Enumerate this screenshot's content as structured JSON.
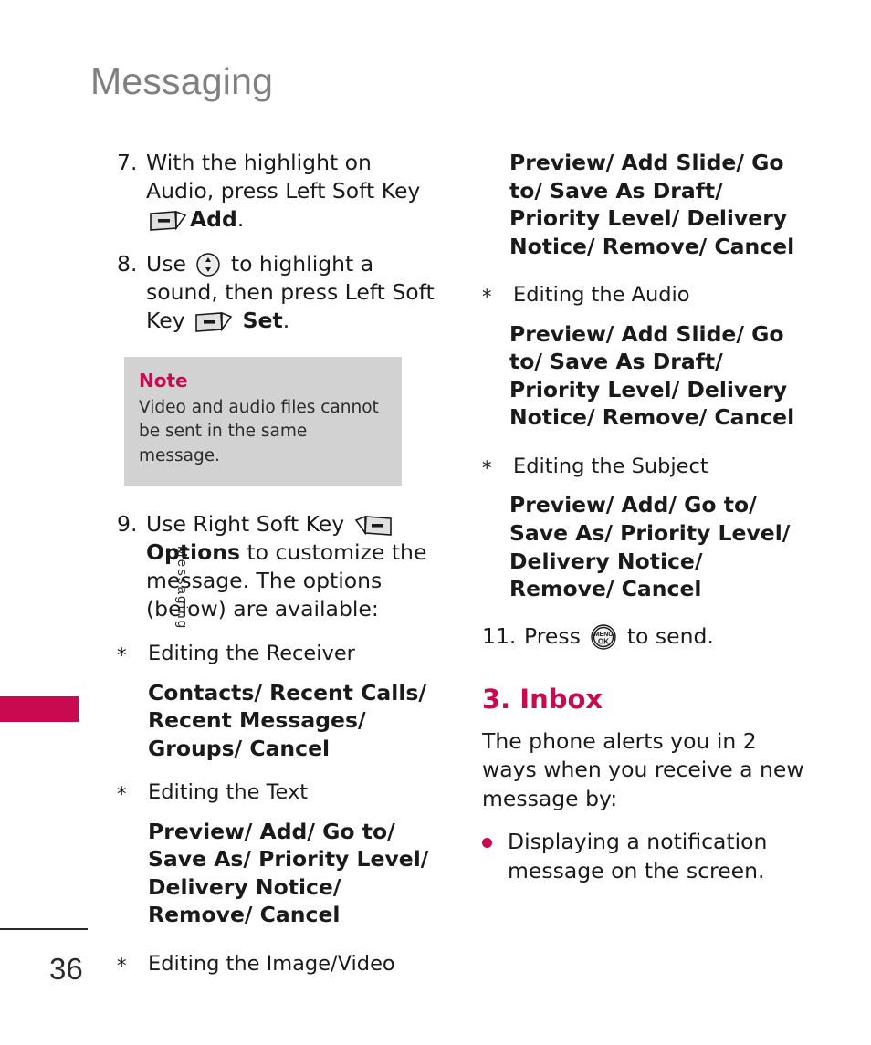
{
  "colors": {
    "accent_magenta": "#c80a50",
    "chapter_gray": "#808080",
    "note_bg": "#d2d2d2",
    "body_text": "#1a1a1a"
  },
  "chapter": {
    "title": "Messaging",
    "side_tab_label": "Messaging"
  },
  "footer": {
    "page_number": "36"
  },
  "icons": {
    "left_soft_key": "left-soft-key-icon",
    "right_soft_key": "right-soft-key-icon",
    "navigation_wheel": "navigation-wheel-icon",
    "menu_ok_key": "menu-ok-key-icon",
    "menu_ok_top_label": "MENU",
    "menu_ok_bottom_label": "OK"
  },
  "left_column": {
    "step7": {
      "number": "7.",
      "text_before": "With the highlight on Audio, press Left Soft Key",
      "text_after": "Add",
      "text_end": "."
    },
    "step8": {
      "number": "8.",
      "text_before": "Use",
      "text_middle": "to highlight a sound, then press Left Soft Key",
      "text_after": "Set",
      "text_end": "."
    },
    "note": {
      "title": "Note",
      "body": "Video and audio files cannot be sent in the same message."
    },
    "step9": {
      "number": "9.",
      "text_before": "Use Right Soft Key",
      "text_bold": "Options",
      "text_after": "to customize the message. The options (below) are available:"
    },
    "bullets": [
      {
        "mark": "*",
        "label": "Editing the Receiver",
        "options": "Contacts/ Recent Calls/ Recent Messages/ Groups/ Cancel"
      },
      {
        "mark": "*",
        "label": "Editing the Text",
        "options": "Preview/ Add/ Go to/ Save As/ Priority Level/ Delivery Notice/ Remove/ Cancel"
      },
      {
        "mark": "*",
        "label": "Editing the Image/Video",
        "options": ""
      }
    ]
  },
  "right_column": {
    "continued_options": "Preview/ Add Slide/ Go to/ Save As Draft/ Priority Level/ Delivery Notice/ Remove/ Cancel",
    "bullets": [
      {
        "mark": "*",
        "label": "Editing the Audio",
        "options": "Preview/ Add Slide/ Go to/ Save As Draft/ Priority Level/ Delivery Notice/ Remove/ Cancel"
      },
      {
        "mark": "*",
        "label": "Editing the Subject",
        "options": "Preview/ Add/ Go to/ Save As/ Priority Level/ Delivery Notice/ Remove/ Cancel"
      }
    ],
    "step11": {
      "number": "11.",
      "text_before": "Press",
      "text_after": "to send."
    },
    "section": {
      "heading": "3. Inbox",
      "paragraph": "The phone alerts you in 2 ways when you receive a new message by:",
      "bullets": [
        {
          "text": "Displaying a notification message on the screen."
        }
      ]
    }
  }
}
